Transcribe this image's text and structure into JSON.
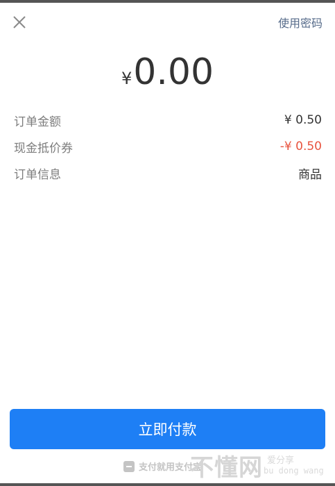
{
  "header": {
    "close_icon": "close-icon",
    "use_password_label": "使用密码"
  },
  "amount": {
    "currency": "¥",
    "value": "0.00"
  },
  "details": [
    {
      "label": "订单金额",
      "value": "¥ 0.50"
    },
    {
      "label": "现金抵价券",
      "value": "-¥ 0.50"
    },
    {
      "label": "订单信息",
      "value": "商品"
    }
  ],
  "pay_button_label": "立即付款",
  "footer": {
    "brand_text": "支付就用支付宝",
    "watermark_title": "不懂网",
    "watermark_sub1": "爱分享",
    "watermark_sub2": "bu dong wang"
  },
  "colors": {
    "accent": "#1e7ff5",
    "discount": "#e8533e",
    "link": "#566b8a"
  }
}
